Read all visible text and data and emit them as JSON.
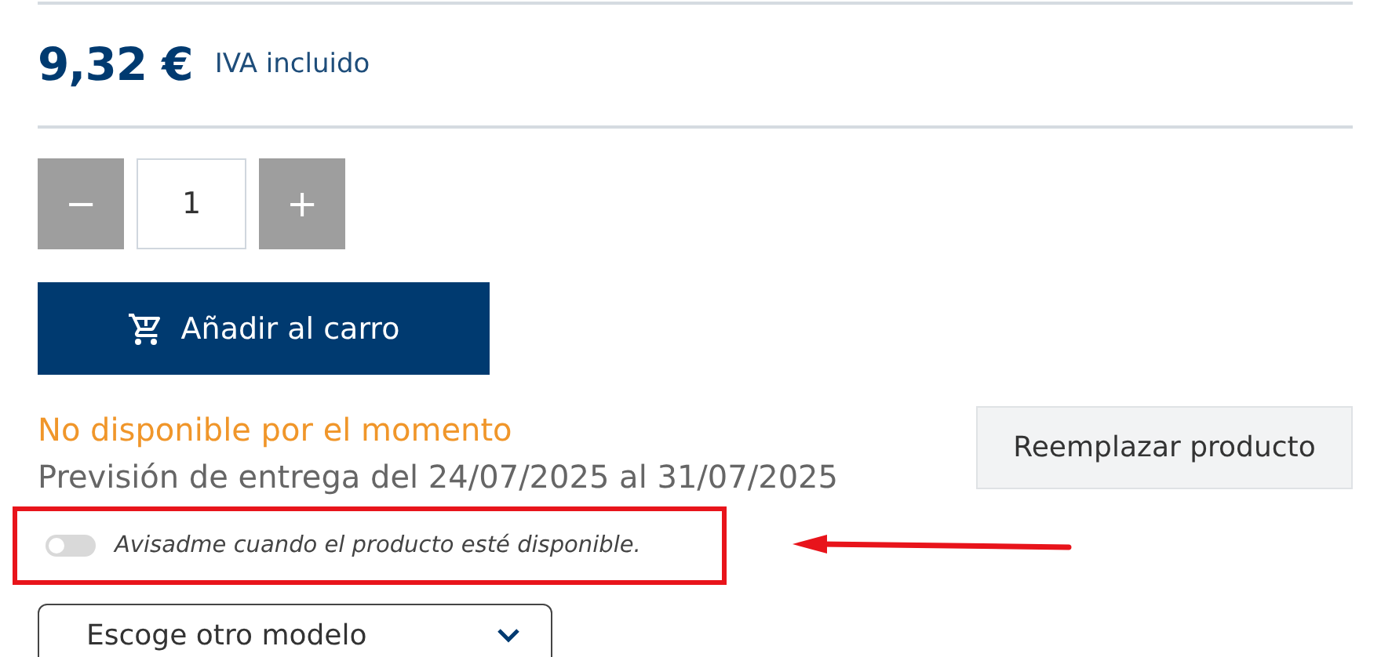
{
  "price": {
    "amount": "9,32 €",
    "tax_note": "IVA incluido"
  },
  "quantity": {
    "decrement": "−",
    "value": "1",
    "increment": "+"
  },
  "add_to_cart": {
    "label": "Añadir al carro"
  },
  "availability": {
    "status": "No disponible por el momento",
    "delivery": "Previsión de entrega del 24/07/2025 al 31/07/2025"
  },
  "replace_button": {
    "label": "Reemplazar producto"
  },
  "notify_toggle": {
    "label": "Avisadme cuando el producto esté disponible.",
    "on": false
  },
  "model_select": {
    "value": "Escoge otro modelo"
  }
}
